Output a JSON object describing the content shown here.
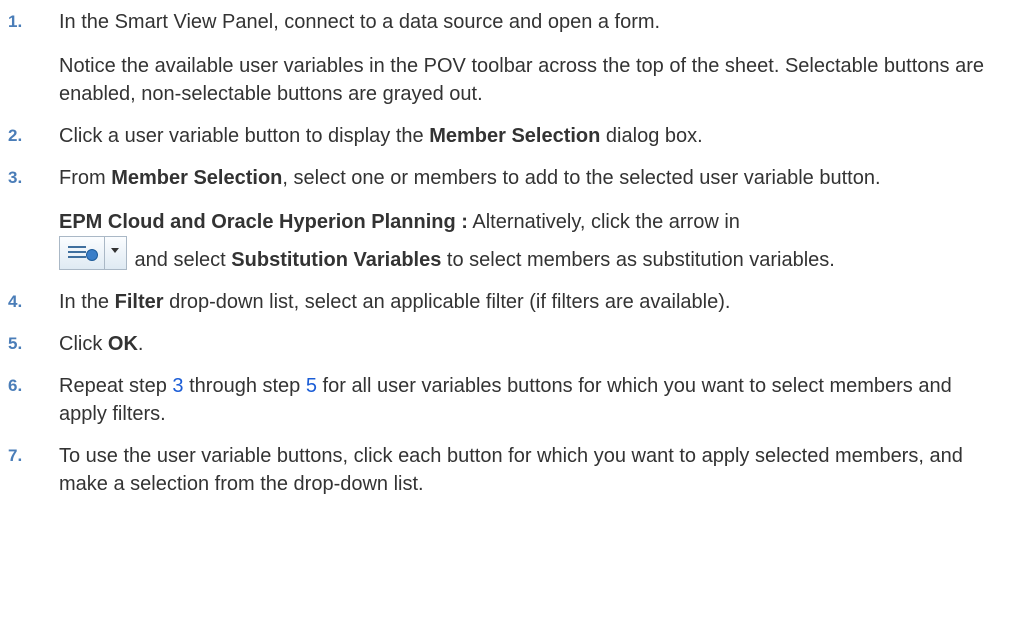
{
  "steps": [
    {
      "num": "1.",
      "line1": "In the Smart View Panel, connect to a data source and open a form.",
      "note": "Notice the available user variables in the POV toolbar across the top of the sheet. Selectable buttons are enabled, non-selectable buttons are grayed out."
    },
    {
      "num": "2.",
      "pre": "Click a user variable button to display the ",
      "bold": "Member Selection",
      "post": " dialog box."
    },
    {
      "num": "3.",
      "pre": "From ",
      "bold": "Member Selection",
      "post": ", select one or members to add to the selected user variable button.",
      "note_bold": "EPM Cloud and Oracle Hyperion Planning :",
      "note_pre": " Alternatively, click the arrow in",
      "note_mid": " and select ",
      "note_bold2": "Substitution Variables",
      "note_post": " to select members as substitution variables."
    },
    {
      "num": "4.",
      "pre": "In the ",
      "bold": "Filter",
      "post": " drop-down list, select an applicable filter (if filters are available)."
    },
    {
      "num": "5.",
      "pre": "Click ",
      "bold": "OK",
      "post": "."
    },
    {
      "num": "6.",
      "pre": "Repeat step ",
      "link1": "3",
      "mid": " through step ",
      "link2": "5",
      "post": " for all user variables buttons for which you want to select members and apply filters."
    },
    {
      "num": "7.",
      "text": "To use the user variable buttons, click each button for which you want to apply selected members, and make a selection from the drop-down list."
    }
  ],
  "icons": {
    "member_selection_combo": "member-selection-dropdown-icon"
  },
  "colors": {
    "step_number": "#4a7db8",
    "link": "#1a5cd6",
    "text": "#333333"
  }
}
